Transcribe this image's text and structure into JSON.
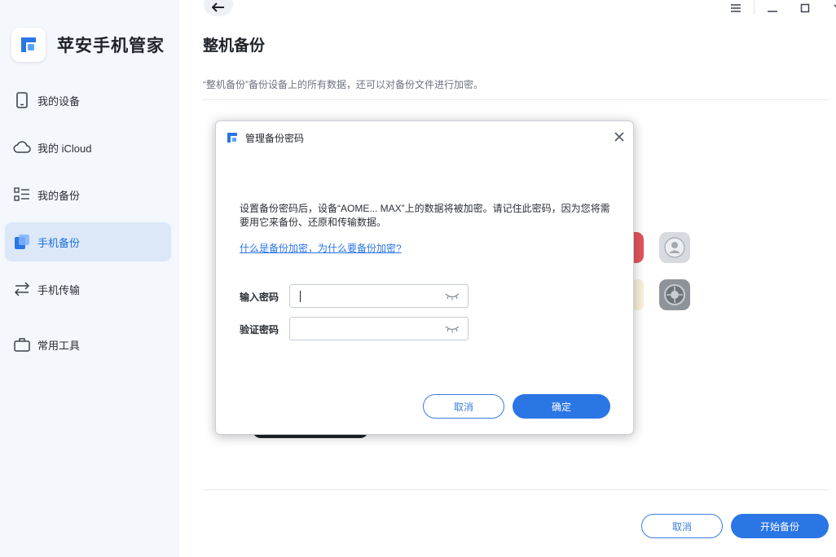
{
  "app": {
    "name": "苹安手机管家"
  },
  "sidebar": {
    "items": [
      {
        "label": "我的设备",
        "icon": "phone-icon"
      },
      {
        "label": "我的 iCloud",
        "icon": "cloud-icon"
      },
      {
        "label": "我的备份",
        "icon": "backup-list-icon"
      },
      {
        "label": "手机备份",
        "icon": "phone-backup-icon",
        "active": true
      },
      {
        "label": "手机传输",
        "icon": "transfer-icon"
      },
      {
        "label": "常用工具",
        "icon": "toolbox-icon"
      }
    ]
  },
  "main": {
    "title": "整机备份",
    "description": "“整机备份”备份设备上的所有数据，还可以对备份文件进行加密。",
    "cancel_label": "取消",
    "start_label": "开始备份"
  },
  "modal": {
    "title": "管理备份密码",
    "message": "设置备份密码后，设备“AOME... MAX”上的数据将被加密。请记住此密码，因为您将需要用它来备份、还原和传输数据。",
    "link": "什么是备份加密，为什么要备份加密?",
    "password_label": "输入密码",
    "password_value": "",
    "verify_label": "验证密码",
    "verify_value": "",
    "cancel_label": "取消",
    "confirm_label": "确定"
  },
  "colors": {
    "accent": "#2b76e5",
    "sidebar_bg": "#f4f7fb",
    "active_bg": "#dce8f8"
  }
}
